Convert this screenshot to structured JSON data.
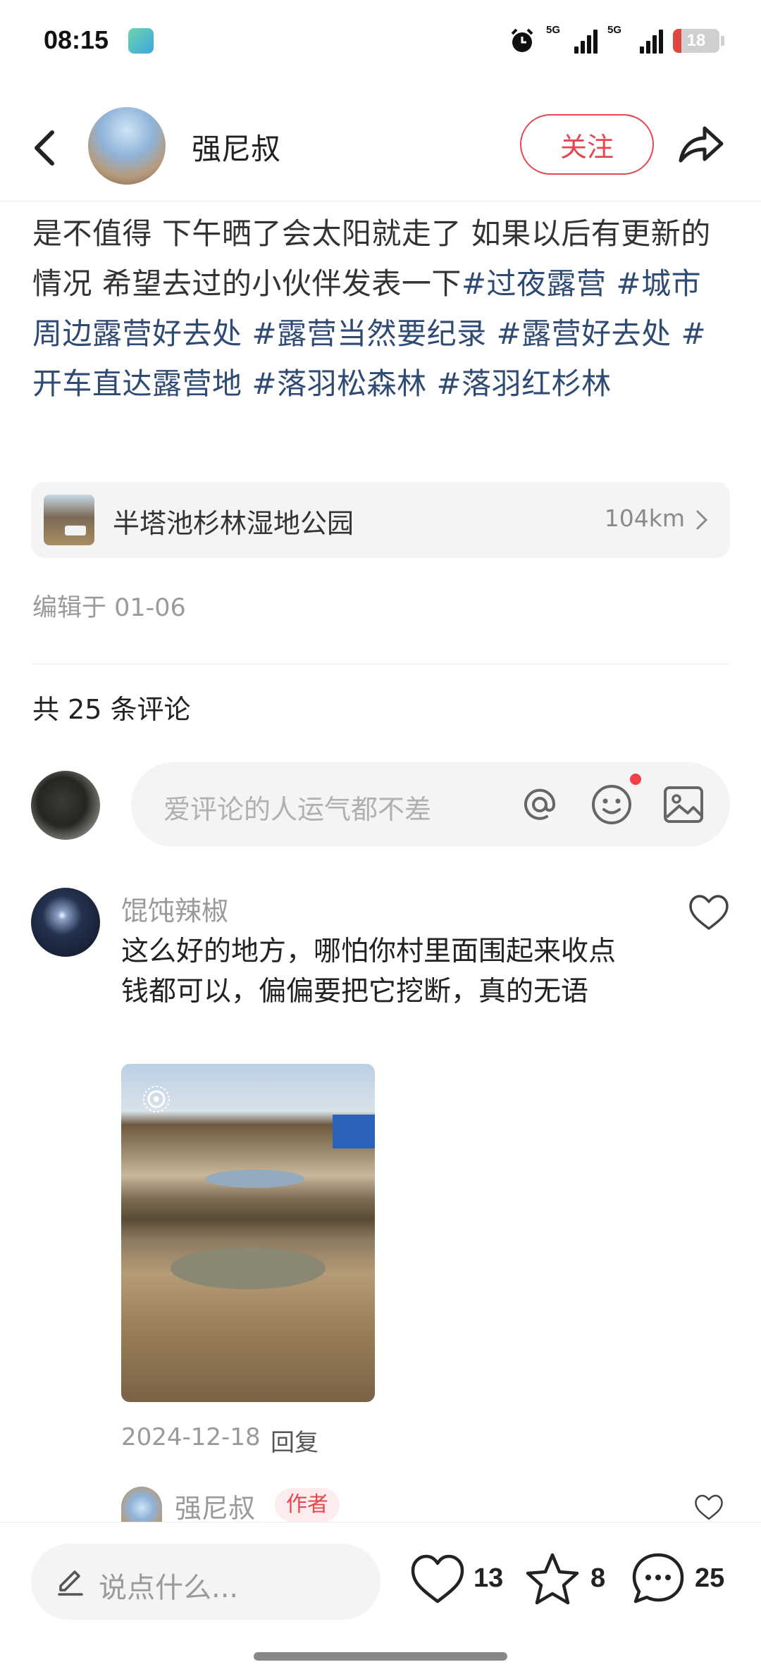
{
  "status_bar": {
    "time": "08:15",
    "net1": "5G",
    "net2": "5G",
    "battery": "18"
  },
  "header": {
    "author_name": "强尼叔",
    "follow_label": "关注"
  },
  "post": {
    "text_segments": [
      {
        "text": "是不值得 下午晒了会太阳就走了 如果以后有更新的情况 希望去过的小伙伴发表一下",
        "tag": false
      },
      {
        "text": "#过夜露营",
        "tag": true
      },
      {
        "text": " ",
        "tag": false
      },
      {
        "text": "#城市周边露营好去处",
        "tag": true
      },
      {
        "text": " ",
        "tag": false
      },
      {
        "text": "#露营当然要纪录",
        "tag": true
      },
      {
        "text": " ",
        "tag": false
      },
      {
        "text": "#露营好去处",
        "tag": true
      },
      {
        "text": " ",
        "tag": false
      },
      {
        "text": "#开车直达露营地",
        "tag": true
      },
      {
        "text": " ",
        "tag": false
      },
      {
        "text": "#落羽松森林",
        "tag": true
      },
      {
        "text": " ",
        "tag": false
      },
      {
        "text": "#落羽红杉林",
        "tag": true
      }
    ],
    "location_name": "半塔池杉林湿地公园",
    "location_distance": "104km",
    "edited": "编辑于 01-06"
  },
  "comments_section": {
    "count_label": "共 25 条评论",
    "input_placeholder": "爱评论的人运气都不差"
  },
  "comment": {
    "author": "馄饨辣椒",
    "text": "这么好的地方，哪怕你村里面围起来收点钱都可以，偏偏要把它挖断，真的无语",
    "date": "2024-12-18",
    "reply_label": "回复"
  },
  "reply": {
    "author": "强尼叔",
    "badge": "作者"
  },
  "bottom_bar": {
    "placeholder": "说点什么...",
    "likes": "13",
    "stars": "8",
    "comments": "25"
  },
  "colors": {
    "accent": "#e5484f",
    "tag": "#2f4a73"
  }
}
